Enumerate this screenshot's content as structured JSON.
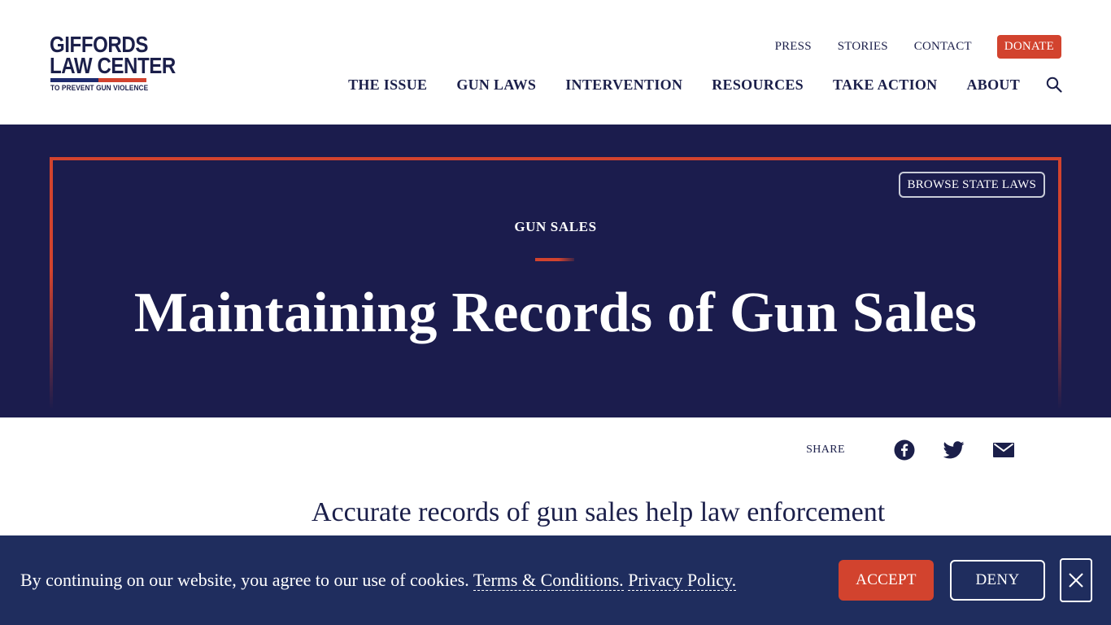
{
  "logo": {
    "line1": "GIFFORDS",
    "line2": "LAW CENTER",
    "tagline": "TO PREVENT GUN VIOLENCE"
  },
  "top_nav": {
    "press": "PRESS",
    "stories": "STORIES",
    "contact": "CONTACT",
    "donate": "DONATE"
  },
  "main_nav": {
    "items": [
      "THE ISSUE",
      "GUN LAWS",
      "INTERVENTION",
      "RESOURCES",
      "TAKE ACTION",
      "ABOUT"
    ],
    "search_icon": "search-icon"
  },
  "hero": {
    "browse_button": "BROWSE STATE LAWS",
    "eyebrow": "GUN SALES",
    "title": "Maintaining Records of Gun Sales"
  },
  "share": {
    "label": "SHARE",
    "icons": [
      "facebook-icon",
      "twitter-icon",
      "email-icon"
    ]
  },
  "intro": {
    "text": "Accurate records of gun sales help law enforcement"
  },
  "cookie_banner": {
    "text": "By continuing on our website, you agree to our use of cookies.",
    "terms_link": "Terms & Conditions.",
    "privacy_link": "Privacy Policy.",
    "accept": "ACCEPT",
    "deny": "DENY",
    "close_icon": "close-icon"
  },
  "colors": {
    "navy": "#1b1c4d",
    "banner_navy": "#1f2d5e",
    "accent_red": "#d2432e",
    "text_dark": "#1b1f4a"
  }
}
